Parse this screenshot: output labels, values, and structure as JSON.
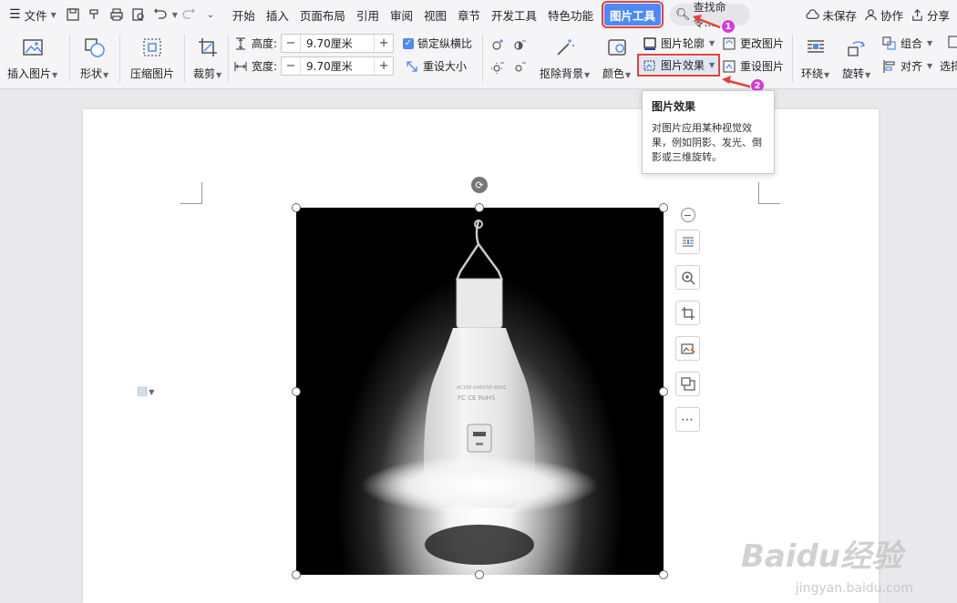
{
  "menubar": {
    "file_label": "文件",
    "tabs": [
      {
        "label": "开始"
      },
      {
        "label": "插入"
      },
      {
        "label": "页面布局"
      },
      {
        "label": "引用"
      },
      {
        "label": "审阅"
      },
      {
        "label": "视图"
      },
      {
        "label": "章节"
      },
      {
        "label": "开发工具"
      },
      {
        "label": "特色功能"
      },
      {
        "label": "图片工具"
      }
    ],
    "search_label": "查找命令...",
    "unsaved_label": "未保存",
    "collab_label": "协作",
    "share_label": "分享"
  },
  "ribbon": {
    "insert_picture": "插入图片",
    "shape": "形状",
    "compress_picture": "压缩图片",
    "crop": "裁剪",
    "height_label": "高度:",
    "height_value": "9.70厘米",
    "width_label": "宽度:",
    "width_value": "9.70厘米",
    "lock_ratio": "锁定纵横比",
    "reset_size": "重设大小",
    "remove_bg": "抠除背景",
    "color": "颜色",
    "picture_outline": "图片轮廓",
    "picture_effect": "图片效果",
    "change_picture": "更改图片",
    "reset_picture": "重设图片",
    "wrap": "环绕",
    "rotate": "旋转",
    "group": "组合",
    "align": "对齐",
    "select": "选择"
  },
  "tooltip": {
    "title": "图片效果",
    "body": "对图片应用某种视觉效果，例如阴影、发光、倒影或三维旋转。"
  },
  "badges": [
    "1",
    "2"
  ],
  "bulb": {
    "spec_text": "AC100-240V/50-60HZ",
    "marks": "FC CE RoHS"
  },
  "watermark": {
    "logo": "Baidu经验",
    "url": "jingyan.baidu.com"
  },
  "colors": {
    "accent": "#4e8af7",
    "highlight_red": "#e8403b",
    "badge_magenta": "#d63bd8"
  }
}
